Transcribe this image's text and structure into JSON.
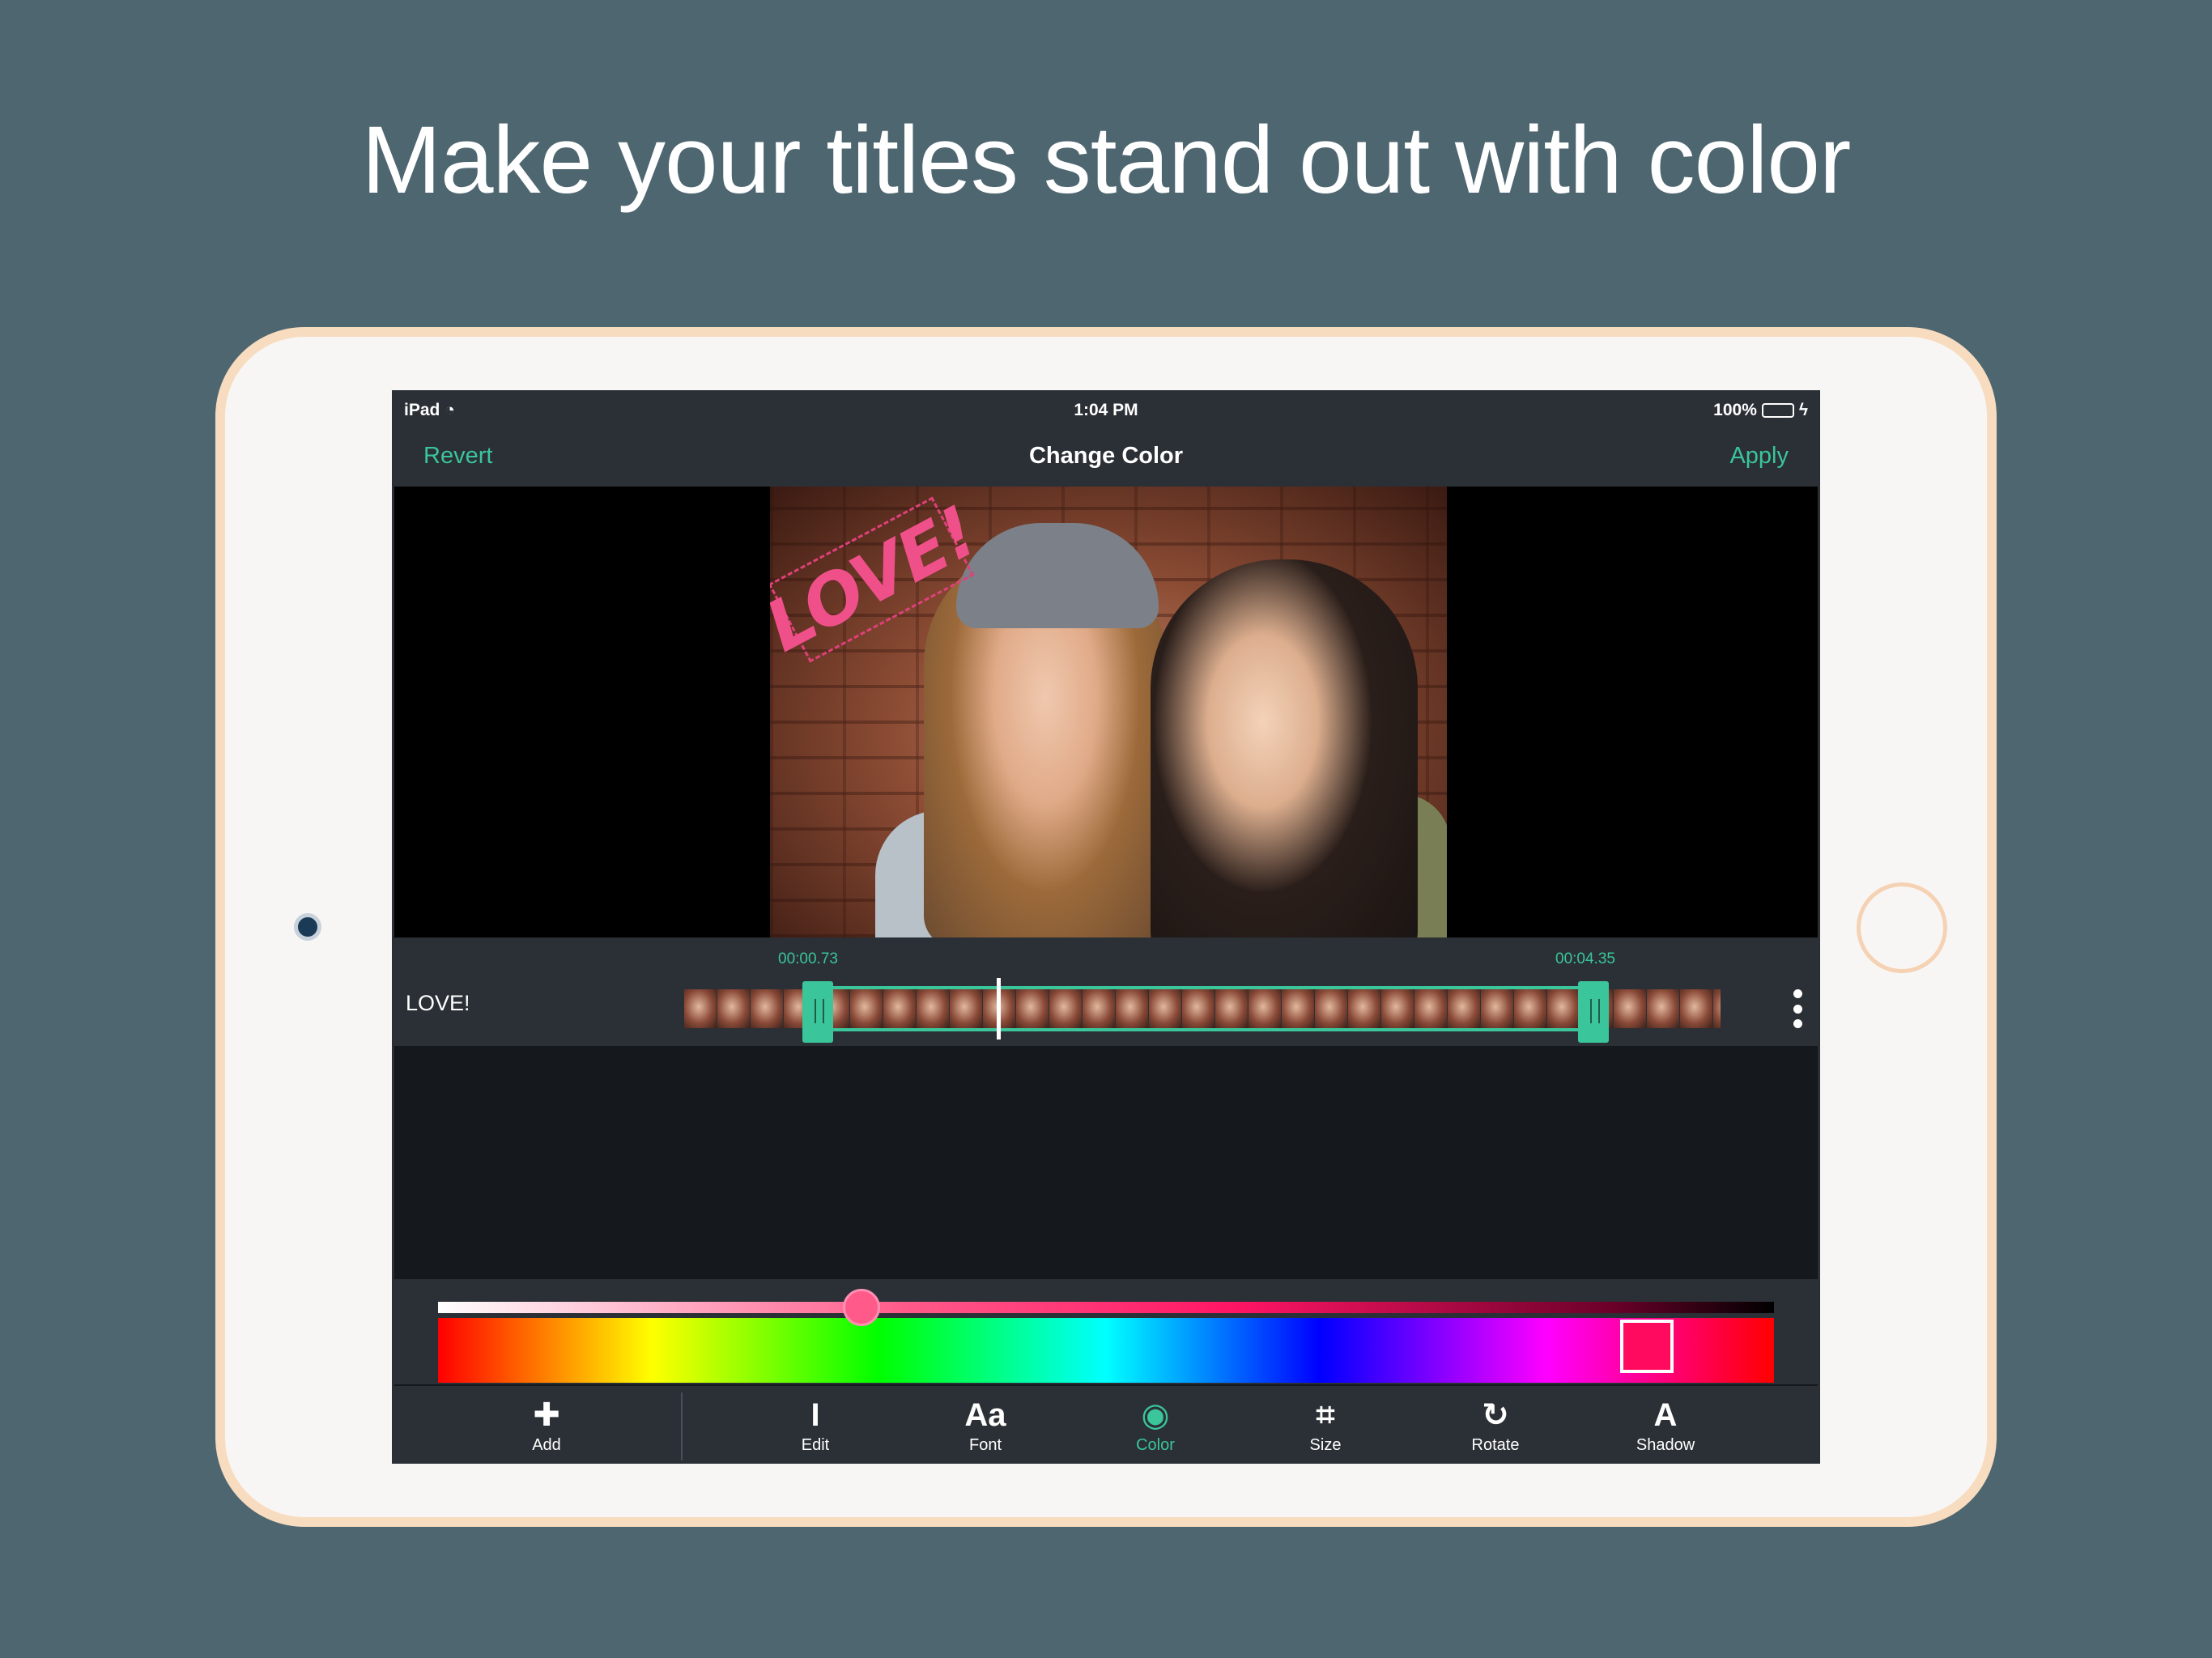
{
  "headline": "Make your titles stand out with color",
  "status_bar": {
    "device": "iPad",
    "time": "1:04 PM",
    "battery": "100%"
  },
  "nav": {
    "left_label": "Revert",
    "title": "Change Color",
    "right_label": "Apply"
  },
  "preview": {
    "title_text": "LOVE!",
    "title_color": "#f0508a"
  },
  "timeline": {
    "track_label": "LOVE!",
    "start_time": "00:00.73",
    "end_time": "00:04.35"
  },
  "color_picker": {
    "selected_color": "#ff0a5e",
    "accent": "#3ac59a"
  },
  "toolbar": {
    "items": [
      {
        "label": "Add",
        "icon": "plus-icon",
        "glyph": "✚"
      },
      {
        "label": "Edit",
        "icon": "text-cursor-icon",
        "glyph": "I"
      },
      {
        "label": "Font",
        "icon": "font-icon",
        "glyph": "Aa"
      },
      {
        "label": "Color",
        "icon": "palette-icon",
        "glyph": "◉"
      },
      {
        "label": "Size",
        "icon": "crop-icon",
        "glyph": "⌗"
      },
      {
        "label": "Rotate",
        "icon": "rotate-icon",
        "glyph": "↻"
      },
      {
        "label": "Shadow",
        "icon": "shadow-icon",
        "glyph": "A"
      }
    ],
    "active": "Color"
  }
}
